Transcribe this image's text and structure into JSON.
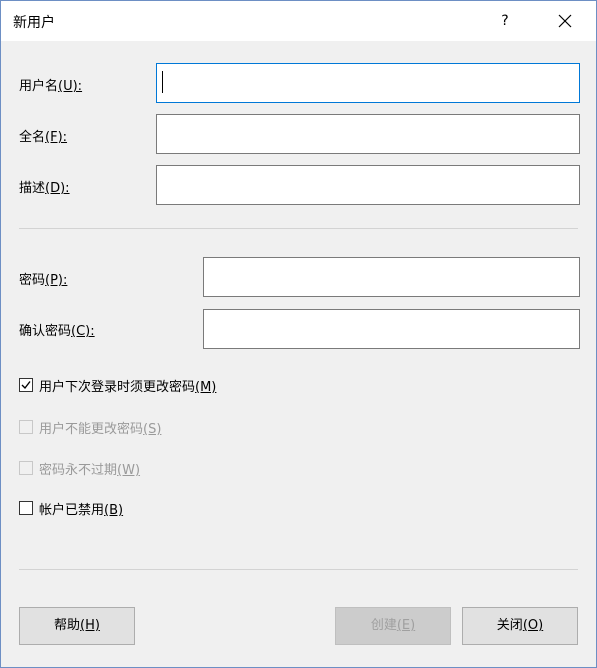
{
  "window": {
    "title": "新用户",
    "help_glyph": "?"
  },
  "form": {
    "username": {
      "label": "用户名",
      "mnemonic": "(U):",
      "value": ""
    },
    "fullname": {
      "label": "全名",
      "mnemonic": "(F):",
      "value": ""
    },
    "description": {
      "label": "描述",
      "mnemonic": "(D):",
      "value": ""
    },
    "password": {
      "label": "密码",
      "mnemonic": "(P):",
      "value": ""
    },
    "confirm": {
      "label": "确认密码",
      "mnemonic": "(C):",
      "value": ""
    }
  },
  "options": [
    {
      "label": "用户下次登录时须更改密码",
      "mnemonic": "(M)",
      "checked": true,
      "enabled": true
    },
    {
      "label": "用户不能更改密码",
      "mnemonic": "(S)",
      "checked": false,
      "enabled": false
    },
    {
      "label": "密码永不过期",
      "mnemonic": "(W)",
      "checked": false,
      "enabled": false
    },
    {
      "label": "帐户已禁用",
      "mnemonic": "(B)",
      "checked": false,
      "enabled": true
    }
  ],
  "buttons": {
    "help": {
      "label": "帮助",
      "mnemonic": "(H)"
    },
    "create": {
      "label": "创建",
      "mnemonic": "(E)",
      "enabled": false
    },
    "close": {
      "label": "关闭",
      "mnemonic": "(O)"
    }
  }
}
